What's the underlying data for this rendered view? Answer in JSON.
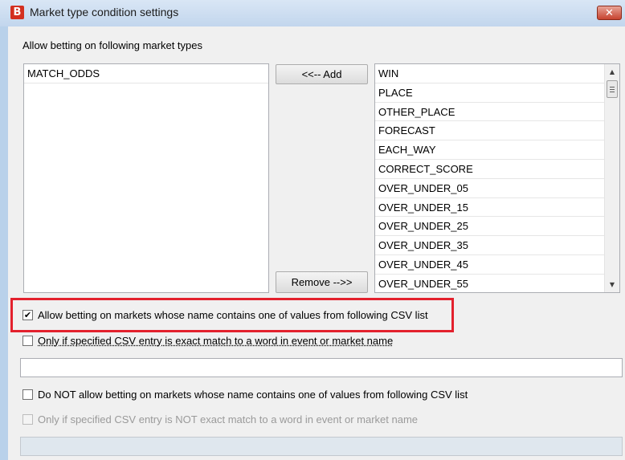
{
  "window": {
    "title": "Market type condition settings",
    "app_icon_glyph": "B",
    "close_glyph": "✕"
  },
  "main": {
    "section_label": "Allow betting on following market types",
    "selected_list": [
      "MATCH_ODDS"
    ],
    "add_button": "<<-- Add",
    "remove_button": "Remove -->>",
    "available_list": [
      "WIN",
      "PLACE",
      "OTHER_PLACE",
      "FORECAST",
      "EACH_WAY",
      "CORRECT_SCORE",
      "OVER_UNDER_05",
      "OVER_UNDER_15",
      "OVER_UNDER_25",
      "OVER_UNDER_35",
      "OVER_UNDER_45",
      "OVER_UNDER_55"
    ]
  },
  "options": {
    "allow_contains_label": "Allow betting on markets whose name contains one of values from following CSV list",
    "allow_contains_checked": true,
    "allow_exact_label": "Only if specified CSV entry is exact match to a word in event or market name",
    "allow_exact_checked": false,
    "allow_csv_value": "",
    "disallow_contains_label": "Do NOT allow betting on markets whose name contains one of values from following CSV list",
    "disallow_contains_checked": false,
    "disallow_exact_label": "Only if specified CSV entry is NOT exact match to a word in event or market name",
    "disallow_exact_checked": false,
    "disallow_csv_value": ""
  },
  "colors": {
    "highlight": "#e3212d",
    "app_icon": "#d32f1f"
  }
}
